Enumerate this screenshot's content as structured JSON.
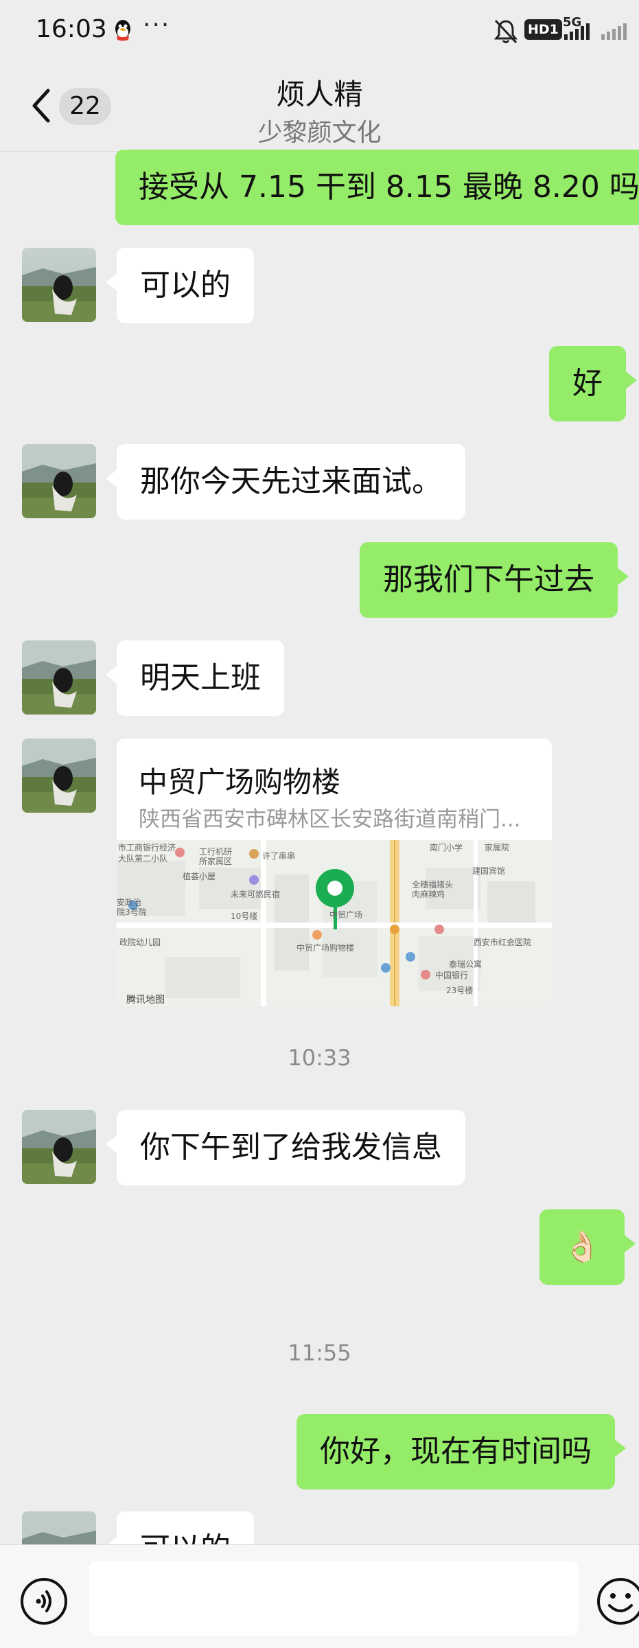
{
  "status_bar": {
    "time": "16:03",
    "dots": "···",
    "hd_badge": "HD1",
    "network": "5G"
  },
  "header": {
    "unread_count": "22",
    "title": "烦人精",
    "subtitle": "少黎颜文化"
  },
  "messages": [
    {
      "side": "out",
      "text": "接受从 7.15 干到 8.15 最晚 8.20 吗"
    },
    {
      "side": "in",
      "text": "可以的"
    },
    {
      "side": "out",
      "text": "好"
    },
    {
      "side": "in",
      "text": "那你今天先过来面试。"
    },
    {
      "side": "out",
      "text": "那我们下午过去"
    },
    {
      "side": "in",
      "text": "明天上班"
    },
    {
      "side": "in",
      "type": "location",
      "title": "中贸广场购物楼",
      "address": "陕西省西安市碑林区长安路街道南稍门..."
    },
    {
      "type": "time",
      "text": "10:33"
    },
    {
      "side": "in",
      "text": "你下午到了给我发信息"
    },
    {
      "side": "out",
      "text": "👌🏻"
    },
    {
      "type": "time",
      "text": "11:55"
    },
    {
      "side": "out",
      "text": "你好，现在有时间吗"
    },
    {
      "side": "in",
      "text": "可以的"
    }
  ],
  "map_labels": {
    "l1": "市工商银行经济",
    "l2": "大队第二小队",
    "l3": "工行机研",
    "l4": "所家属区",
    "l5": "许了串串",
    "l6": "植荟小屋",
    "l7": "未来可燃民宿",
    "l8": "10号楼",
    "l9": "安政治",
    "l10": "院3号院",
    "l11": "政院幼儿园",
    "l12": "中贸广场",
    "l13": "中贸广场购物楼",
    "l14": "南门小学",
    "l15": "家属院",
    "l16": "建国宾馆",
    "l17": "全穗福猪头",
    "l18": "肉麻辣鸡",
    "l19": "西安市红会医院",
    "l20": "泰瑞公寓",
    "l21": "中国银行",
    "l22": "23号楼",
    "brand": "腾讯地图"
  },
  "colors": {
    "outgoing_bubble": "#95ec69",
    "incoming_bubble": "#ffffff",
    "background": "#ededed",
    "map_pin": "#1aad52"
  },
  "icons": {
    "back": "chevron-left-icon",
    "voice": "voice-icon",
    "emoji": "emoji-icon"
  }
}
